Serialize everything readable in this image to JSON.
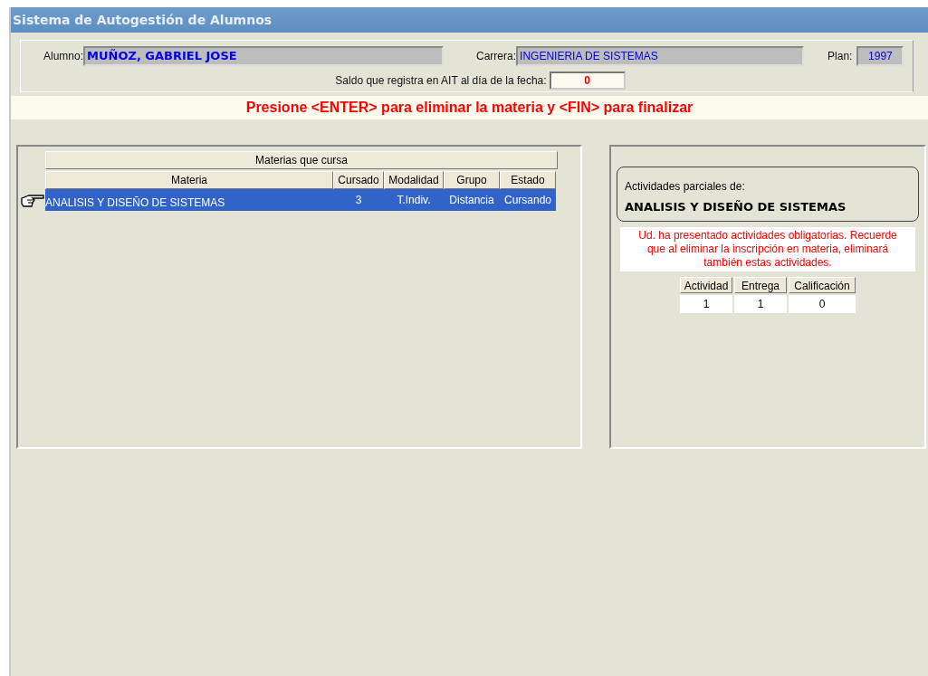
{
  "window": {
    "title": "Sistema de Autogestión de Alumnos"
  },
  "student": {
    "alumno_label": "Alumno:",
    "alumno": "MUÑOZ, GABRIEL JOSE",
    "carrera_label": "Carrera:",
    "carrera": "INGENIERIA DE SISTEMAS",
    "plan_label": "Plan:",
    "plan": "1997",
    "saldo_label": "Saldo que registra en AIT al día de la fecha:",
    "saldo": "0"
  },
  "banner": "Presione <ENTER> para eliminar la materia y <FIN> para finalizar",
  "subjects": {
    "title": "Materias que cursa",
    "columns": [
      "Materia",
      "Cursado",
      "Modalidad",
      "Grupo",
      "Estado"
    ],
    "rows": [
      {
        "cells": [
          "ANALISIS Y DISEÑO DE SISTEMAS",
          "3",
          "T.Indiv.",
          "Distancia",
          "Cursando"
        ],
        "selected": true
      }
    ]
  },
  "activities": {
    "heading": "Actividades parciales de:",
    "subject": "ANALISIS Y DISEÑO DE SISTEMAS",
    "warning": "Ud. ha presentado actividades obligatorias. Recuerde que al eliminar la inscripción en materia, eliminará también estas actividades.",
    "columns": [
      "Actividad",
      "Entrega",
      "Calificación"
    ],
    "rows": [
      [
        "1",
        "1",
        "0"
      ]
    ]
  }
}
